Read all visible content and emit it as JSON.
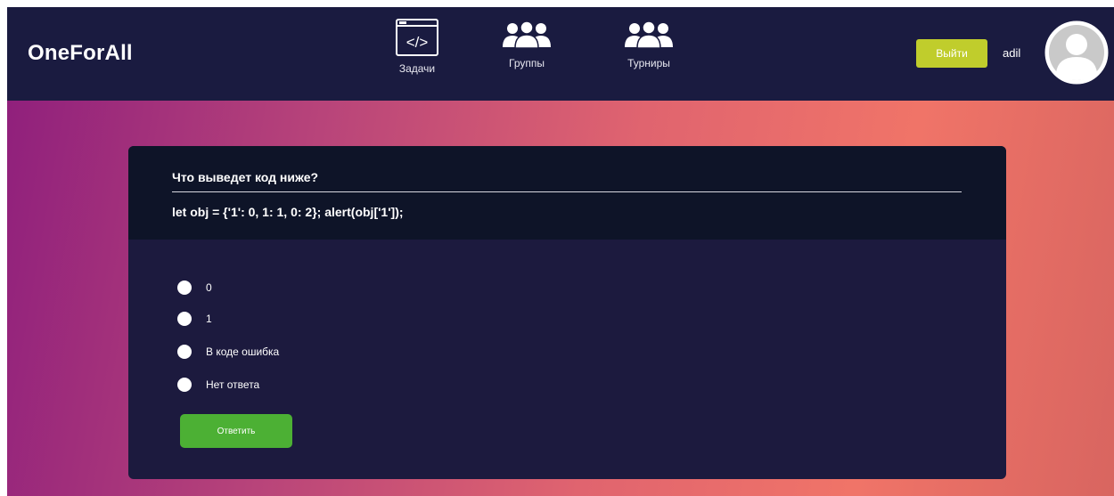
{
  "header": {
    "logo": "OneForAll",
    "nav": [
      {
        "label": "Задачи",
        "icon": "code-window-icon"
      },
      {
        "label": "Группы",
        "icon": "group-icon"
      },
      {
        "label": "Турниры",
        "icon": "group-icon"
      }
    ],
    "logout_label": "Выйти",
    "username": "adil",
    "avatar_icon": "user-avatar-icon"
  },
  "question": {
    "title": "Что выведет код ниже?",
    "code": "let obj = {'1': 0, 1: 1, 0: 2}; alert(obj['1']);",
    "options": [
      "0",
      "1",
      "В коде ошибка",
      "Нет ответа"
    ],
    "submit_label": "Ответить"
  },
  "colors": {
    "navbar": "#1a1b40",
    "logout_button": "#c0cd2c",
    "submit_button": "#4cb034",
    "card": "#1c1a3e",
    "card_header": "#0e1428"
  }
}
